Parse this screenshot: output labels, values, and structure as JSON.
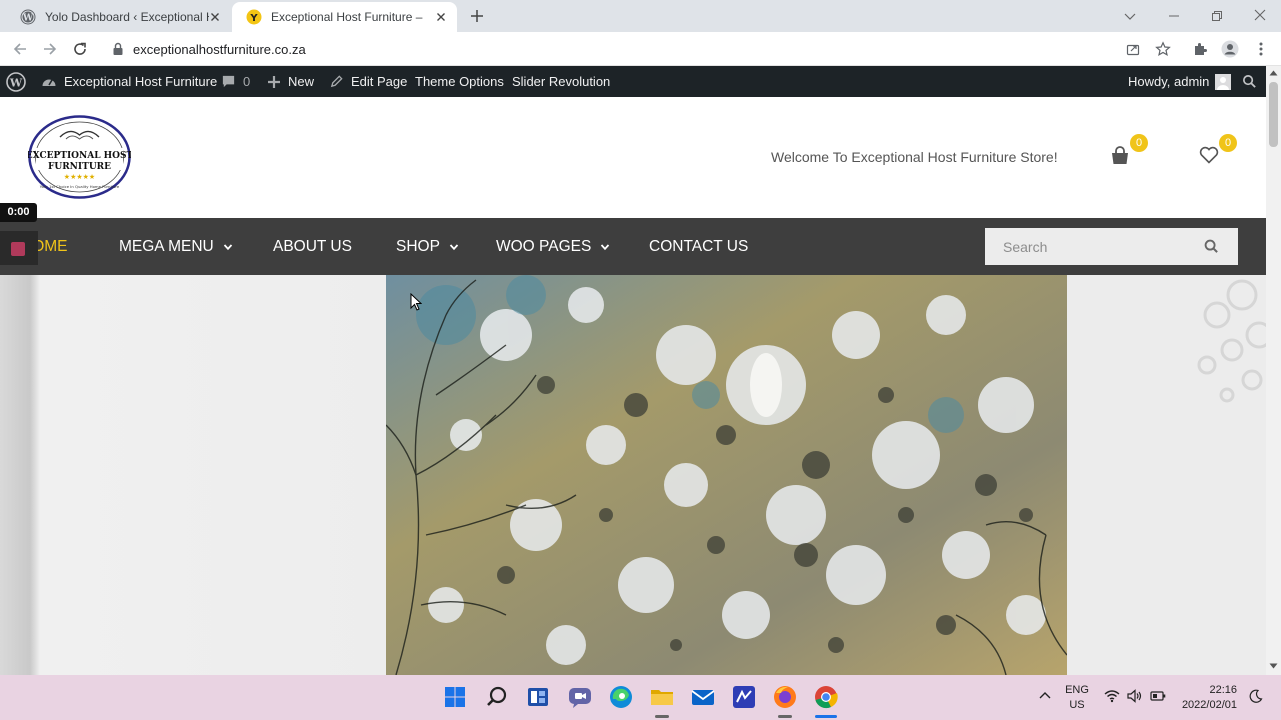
{
  "browser": {
    "tabs": [
      {
        "title": "Yolo Dashboard ‹ Exceptional Ho",
        "active": false,
        "icon": "wordpress-icon"
      },
      {
        "title": "Exceptional Host Furniture – Furn",
        "active": true,
        "icon": "yoast-icon"
      }
    ],
    "address": "exceptionalhostfurniture.co.za"
  },
  "admin_bar": {
    "site_name": "Exceptional Host Furniture",
    "comments_count": "0",
    "new_label": "New",
    "edit_label": "Edit Page",
    "theme_options_label": "Theme Options",
    "slider_label": "Slider Revolution",
    "howdy": "Howdy, admin"
  },
  "header": {
    "logo_line1": "EXCEPTIONAL HOST",
    "logo_line2": "FURNITURE",
    "logo_arc": "Your 1st Choice In Quality Home Furniture",
    "welcome": "Welcome To Exceptional Host Furniture Store!",
    "cart_count": "0",
    "wishlist_count": "0"
  },
  "video_overlay": {
    "time": "0:00"
  },
  "nav": {
    "items": [
      {
        "label": "HOME",
        "dropdown": false,
        "active": true
      },
      {
        "label": "MEGA MENU",
        "dropdown": true
      },
      {
        "label": "ABOUT US",
        "dropdown": false
      },
      {
        "label": "SHOP",
        "dropdown": true
      },
      {
        "label": "WOO PAGES",
        "dropdown": true
      },
      {
        "label": "CONTACT US",
        "dropdown": false
      }
    ],
    "search_placeholder": "Search",
    "active_color": "#f0c419"
  },
  "taskbar": {
    "lang1": "ENG",
    "lang2": "US",
    "time": "22:16",
    "date": "2022/02/01"
  },
  "colors": {
    "admin_bar": "#1d2327",
    "nav_bg": "#3e3e3e",
    "accent": "#f0c419"
  }
}
